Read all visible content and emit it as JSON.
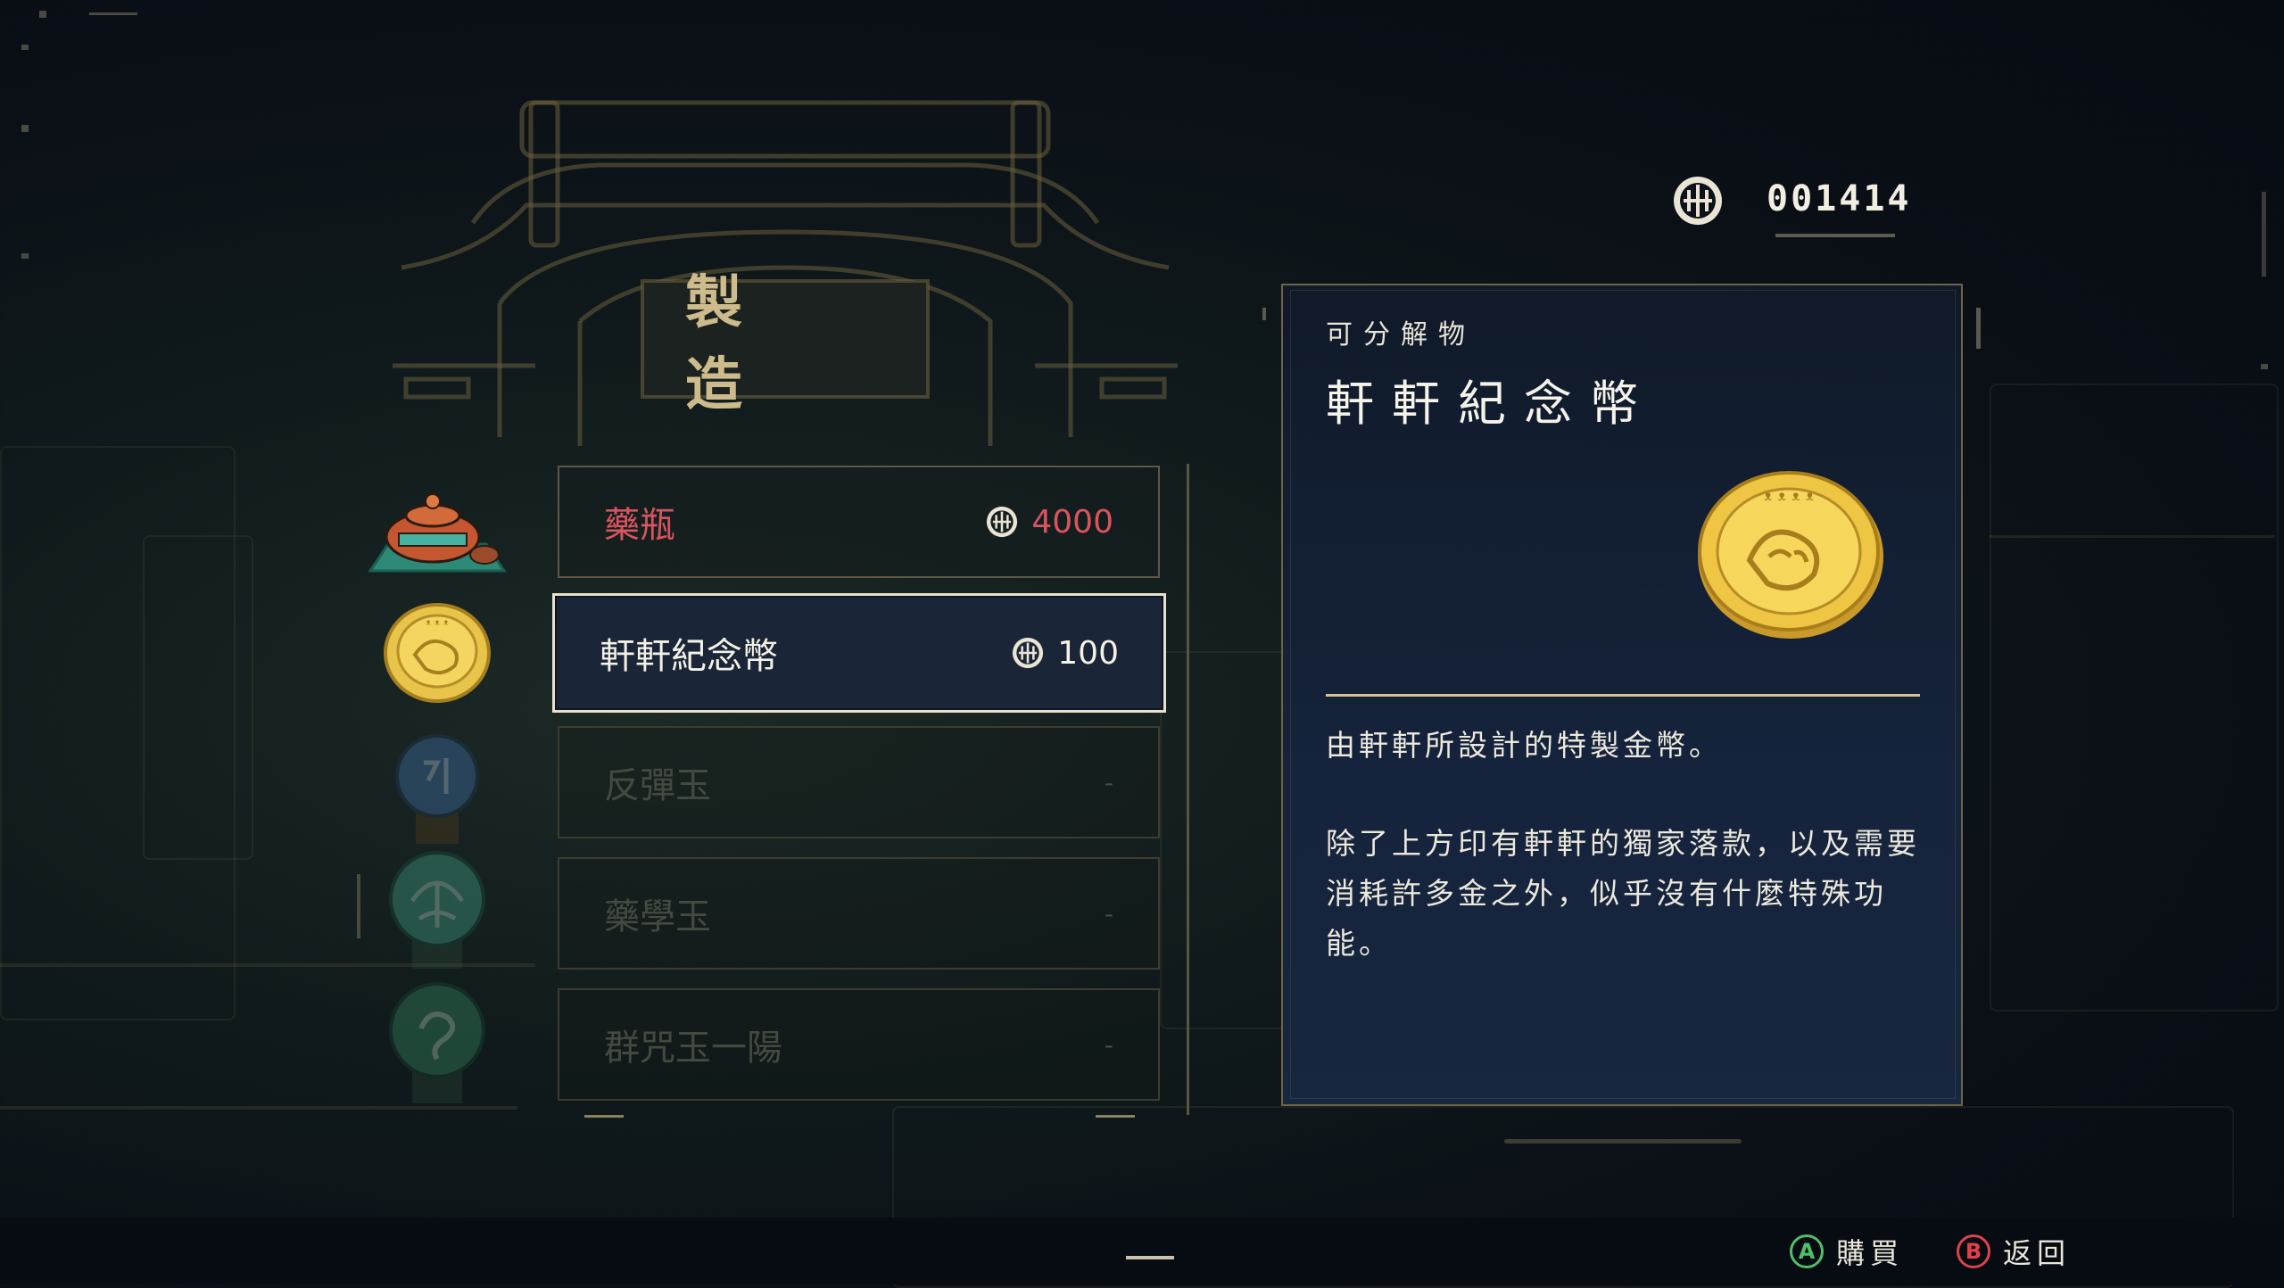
{
  "header": {
    "title": "製 造"
  },
  "currency": {
    "icon": "yin-yang-coin-icon",
    "amount": "001414"
  },
  "items": [
    {
      "name": "藥瓶",
      "price": "4000",
      "state": "unaffordable",
      "icon": "medicine-pot-icon"
    },
    {
      "name": "軒軒紀念幣",
      "price": "100",
      "state": "selected",
      "icon": "gold-coin-icon"
    },
    {
      "name": "反彈玉",
      "price": "-",
      "state": "locked",
      "icon": "jade-rebound-icon"
    },
    {
      "name": "藥學玉",
      "price": "-",
      "state": "locked",
      "icon": "jade-medicine-icon"
    },
    {
      "name": "群咒玉一陽",
      "price": "-",
      "state": "locked",
      "icon": "jade-yang-icon"
    }
  ],
  "detail": {
    "category": "可分解物",
    "title": "軒軒紀念幣",
    "image": "gold-coin-icon",
    "description": [
      "由軒軒所設計的特製金幣。",
      "除了上方印有軒軒的獨家落款，以及需要消耗許多金之外，似乎沒有什麼特殊功能。"
    ]
  },
  "prompts": {
    "confirm": {
      "button": "A",
      "label": "購買"
    },
    "back": {
      "button": "B",
      "label": "返回"
    }
  },
  "colors": {
    "unaffordable": "#d9545e",
    "selected_bg": "#1b2538",
    "gold": "#d8c48a",
    "button_a": "#4fc06a",
    "button_b": "#e0424c"
  }
}
